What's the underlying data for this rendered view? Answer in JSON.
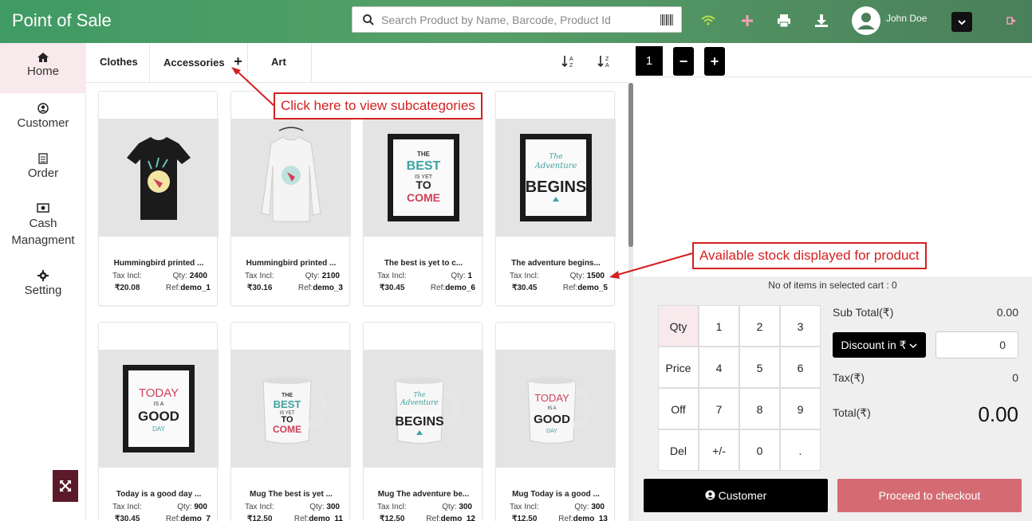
{
  "app": {
    "title": "Point of Sale"
  },
  "search": {
    "placeholder": "Search Product by Name, Barcode, Product Id"
  },
  "topbar": {
    "user_name": "John Doe",
    "icons": [
      "wifi-icon",
      "plus-icon",
      "printer-icon",
      "download-icon",
      "user-avatar-icon",
      "chevron-down-icon",
      "logout-icon"
    ]
  },
  "sidebar": {
    "items": [
      {
        "label": "Home",
        "icon": "home-icon"
      },
      {
        "label": "Customer",
        "icon": "user-circle-icon"
      },
      {
        "label": "Order",
        "icon": "document-icon"
      },
      {
        "label": "Cash Managment",
        "icon": "money-icon"
      },
      {
        "label": "Setting",
        "icon": "gear-icon"
      }
    ]
  },
  "categories": [
    {
      "label": "Clothes"
    },
    {
      "label": "Accessories",
      "expand": "+"
    },
    {
      "label": "Art"
    }
  ],
  "products": [
    {
      "name": "Hummingbird printed ...",
      "tax_label": "Tax Incl:",
      "qty_label": "Qty:",
      "qty": "2400",
      "price": "₹20.08",
      "ref_label": "Ref:",
      "ref": "demo_1",
      "image": "black-tshirt"
    },
    {
      "name": "Hummingbird printed ...",
      "tax_label": "Tax Incl:",
      "qty_label": "Qty:",
      "qty": "2100",
      "price": "₹30.16",
      "ref_label": "Ref:",
      "ref": "demo_3",
      "image": "white-sweater"
    },
    {
      "name": "The best is yet to c...",
      "tax_label": "Tax Incl:",
      "qty_label": "Qty:",
      "qty": "1",
      "price": "₹30.45",
      "ref_label": "Ref:",
      "ref": "demo_6",
      "image": "poster-best"
    },
    {
      "name": "The adventure begins...",
      "tax_label": "Tax Incl:",
      "qty_label": "Qty:",
      "qty": "1500",
      "price": "₹30.45",
      "ref_label": "Ref:",
      "ref": "demo_5",
      "image": "poster-adventure"
    },
    {
      "name": "Today is a good day ...",
      "tax_label": "Tax Incl:",
      "qty_label": "Qty:",
      "qty": "900",
      "price": "₹30.45",
      "ref_label": "Ref:",
      "ref": "demo_7",
      "image": "poster-today"
    },
    {
      "name": "Mug The best is yet ...",
      "tax_label": "Tax Incl:",
      "qty_label": "Qty:",
      "qty": "300",
      "price": "₹12.50",
      "ref_label": "Ref:",
      "ref": "demo_11",
      "image": "mug-best"
    },
    {
      "name": "Mug The adventure be...",
      "tax_label": "Tax Incl:",
      "qty_label": "Qty:",
      "qty": "300",
      "price": "₹12.50",
      "ref_label": "Ref:",
      "ref": "demo_12",
      "image": "mug-adventure"
    },
    {
      "name": "Mug Today is a good ...",
      "tax_label": "Tax Incl:",
      "qty_label": "Qty:",
      "qty": "300",
      "price": "₹12.50",
      "ref_label": "Ref:",
      "ref": "demo_13",
      "image": "mug-today"
    }
  ],
  "art_text": {
    "best": [
      "THE",
      "BEST",
      "IS YET",
      "TO",
      "COME"
    ],
    "adventure": [
      "The",
      "Adventure",
      "BEGINS"
    ],
    "today": [
      "TODAY",
      "IS A",
      "GOOD",
      "DAY"
    ]
  },
  "cart": {
    "tab": "1",
    "minus": "−",
    "plus": "+",
    "items_count_label": "No of items in selected cart : 0",
    "numpad": [
      [
        "Qty",
        "1",
        "2",
        "3"
      ],
      [
        "Price",
        "4",
        "5",
        "6"
      ],
      [
        "Off",
        "7",
        "8",
        "9"
      ],
      [
        "Del",
        "+/-",
        "0",
        "."
      ]
    ],
    "subtotal_label": "Sub Total(₹)",
    "subtotal": "0.00",
    "discount_label": "Discount in ₹",
    "discount_value": "0",
    "tax_label": "Tax(₹)",
    "tax": "0",
    "total_label": "Total(₹)",
    "total": "0.00",
    "customer_button": "Customer",
    "checkout_button": "Proceed to checkout"
  },
  "annotations": {
    "subcategories": "Click here to view subcategories",
    "stock": "Available stock displayed for product"
  },
  "colors": {
    "accent": "#3f9a63",
    "checkout": "#d46b73",
    "annotation": "#d42020",
    "active_bg": "#f8e9ec"
  }
}
